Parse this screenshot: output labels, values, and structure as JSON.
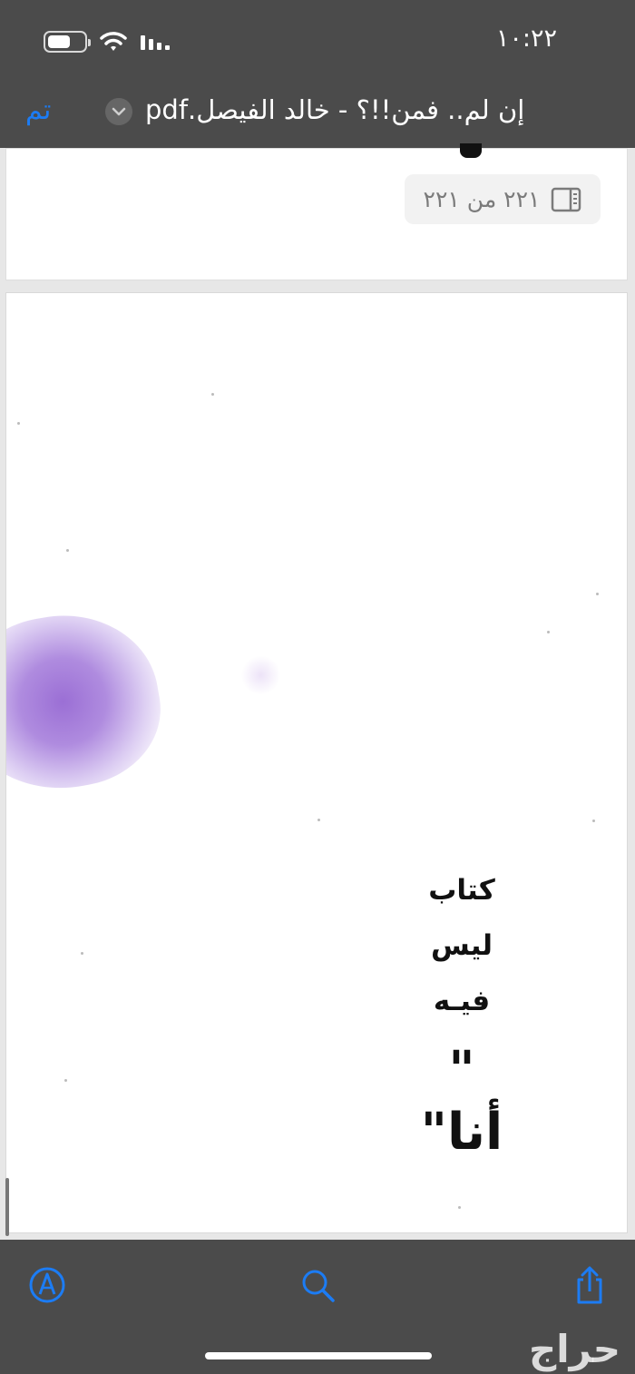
{
  "status": {
    "time": "١٠:٢٢",
    "battery_level": 0.55
  },
  "header": {
    "done_label": "تم",
    "document_title": "إن لم.. فمن!!؟ - خالد الفيصل.pdf",
    "chevron_icon": "chevron-down-icon"
  },
  "page_indicator": {
    "text": "٢٢١ من ٢٢١",
    "icon": "sidebar-icon"
  },
  "page_content": {
    "line1": "كتاب",
    "line2": "ليس",
    "line3": "فيـه",
    "quote": "\" أنا\""
  },
  "toolbar": {
    "markup_icon": "markup-pen-icon",
    "search_icon": "search-icon",
    "share_icon": "share-icon"
  },
  "watermark": {
    "text": "حراج"
  },
  "colors": {
    "bar_background": "#4b4b4b",
    "accent": "#1c7cf4",
    "stain": "#8d5bcf"
  }
}
